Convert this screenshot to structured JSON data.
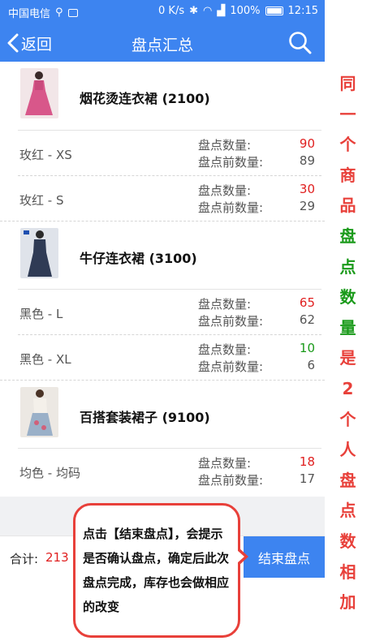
{
  "status_bar": {
    "carrier": "中国电信",
    "speed": "0 K/s",
    "battery": "100%",
    "time": "12:15"
  },
  "nav": {
    "back_label": "返回",
    "title": "盘点汇总"
  },
  "labels": {
    "count": "盘点数量:",
    "before": "盘点前数量:"
  },
  "products": [
    {
      "name": "烟花烫连衣裙 (2100)",
      "variants": [
        {
          "name": "玫红 - XS",
          "count": "90",
          "count_color": "#e02020",
          "before": "89"
        },
        {
          "name": "玫红 - S",
          "count": "30",
          "count_color": "#e02020",
          "before": "29"
        }
      ]
    },
    {
      "name": "牛仔连衣裙 (3100)",
      "variants": [
        {
          "name": "黑色 - L",
          "count": "65",
          "count_color": "#e02020",
          "before": "62"
        },
        {
          "name": "黑色 - XL",
          "count": "10",
          "count_color": "#1a9a1a",
          "before": "6"
        }
      ]
    },
    {
      "name": "百搭套装裙子 (9100)",
      "variants": [
        {
          "name": "均色 - 均码",
          "count": "18",
          "count_color": "#e02020",
          "before": "17"
        }
      ]
    }
  ],
  "footer": {
    "total_label": "合计:",
    "total_value": "213",
    "end_button": "结束盘点"
  },
  "callout": {
    "text": "点击【结束盘点】，会提示是否确认盘点，确定后此次盘点完成，库存也会做相应的改变"
  },
  "annotation": {
    "chars": [
      "同",
      "一",
      "个",
      "商",
      "品",
      "盘",
      "点",
      "数",
      "量",
      "是",
      "2",
      "个",
      "人",
      "盘",
      "点",
      "数",
      "相",
      "加"
    ],
    "colors": [
      "#e8403a",
      "#e8403a",
      "#e8403a",
      "#e8403a",
      "#e8403a",
      "#1a9a1a",
      "#1a9a1a",
      "#1a9a1a",
      "#1a9a1a",
      "#e8403a",
      "#e8403a",
      "#e8403a",
      "#e8403a",
      "#e8403a",
      "#e8403a",
      "#e8403a",
      "#e8403a",
      "#e8403a"
    ]
  }
}
